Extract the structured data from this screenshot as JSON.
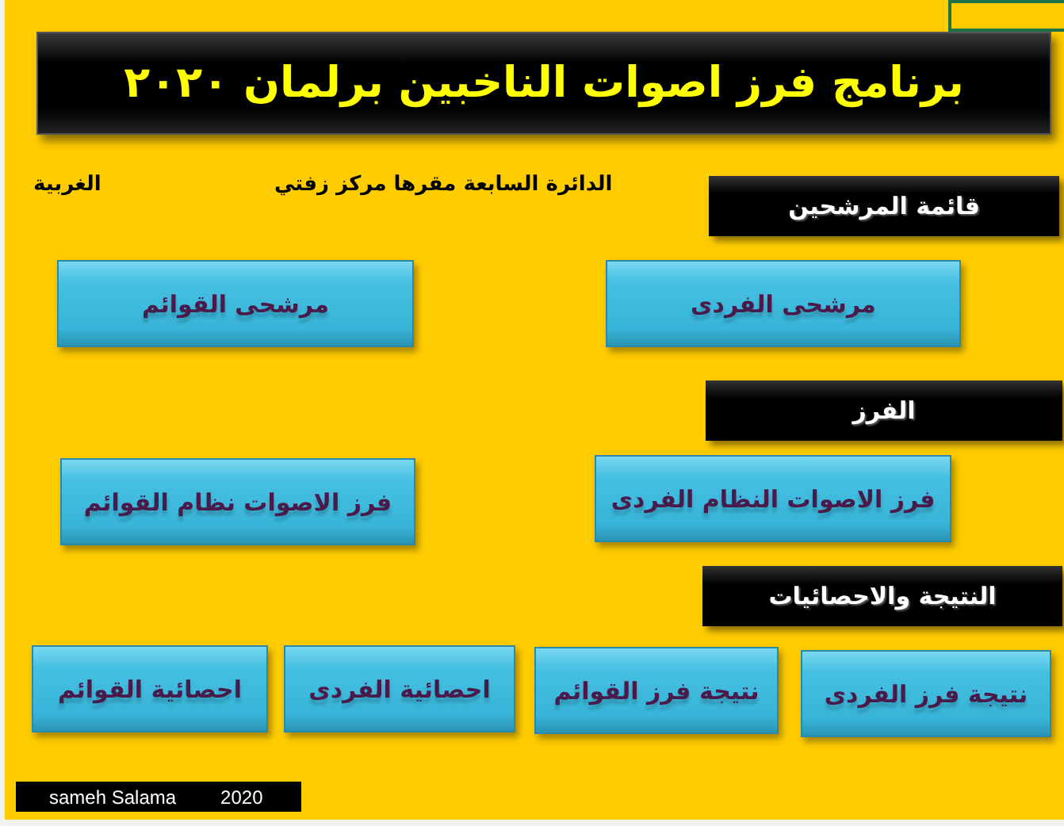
{
  "title": "برنامج فرز اصوات الناخبين برلمان ٢٠٢٠",
  "district": {
    "name": "الدائرة السابعة مقرها مركز زفتي",
    "governorate": "الغربية"
  },
  "sections": [
    {
      "heading": "قائمة المرشحين",
      "buttons": [
        "مرشحى الفردى",
        "مرشحى القوائم"
      ]
    },
    {
      "heading": "الفرز",
      "buttons": [
        "فرز الاصوات النظام الفردى",
        "فرز الاصوات نظام القوائم"
      ]
    },
    {
      "heading": "النتيجة والاحصائيات",
      "buttons": [
        "نتيجة فرز الفردى",
        "نتيجة فرز القوائم",
        "احصائية الفردى",
        "احصائية القوائم"
      ]
    }
  ],
  "footer": {
    "author": "sameh Salama",
    "year": "2020"
  }
}
